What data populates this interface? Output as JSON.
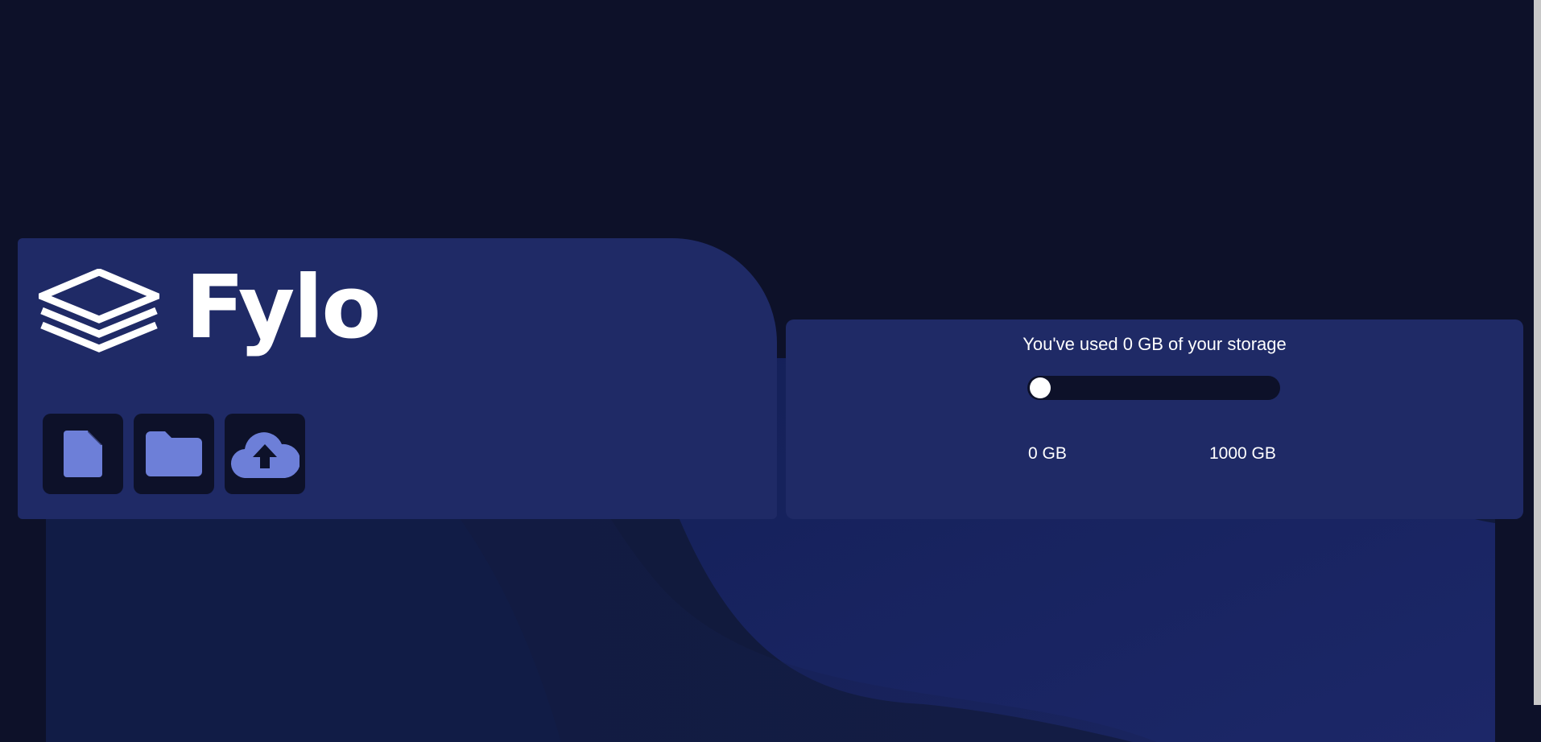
{
  "brand": {
    "name": "Fylo",
    "logo_icon": "layers-icon"
  },
  "actions": [
    {
      "icon": "document-icon",
      "label": "document"
    },
    {
      "icon": "folder-icon",
      "label": "folder"
    },
    {
      "icon": "cloud-upload-icon",
      "label": "upload"
    }
  ],
  "storage": {
    "usage_text": "You've used 0 GB of your storage",
    "used_gb": 0,
    "total_gb": 1000,
    "min_label": "0 GB",
    "max_label": "1000 GB",
    "used_fraction": 0.0
  },
  "colors": {
    "background": "#0d1129",
    "card": "#1f2a66",
    "accent": "#6d7fd8",
    "knob": "#ffffff"
  }
}
